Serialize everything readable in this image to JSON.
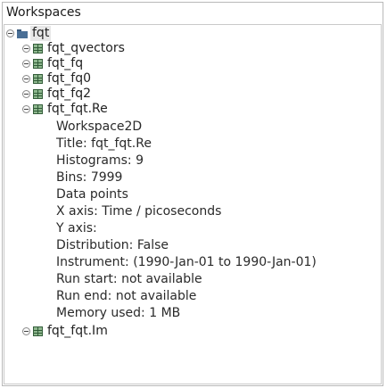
{
  "panel": {
    "title": "Workspaces"
  },
  "tree": {
    "root": {
      "label": "fqt",
      "icon": "folder-icon"
    },
    "items": [
      {
        "label": "fqt_qvectors",
        "icon": "table-icon"
      },
      {
        "label": "fqt_fq",
        "icon": "table-icon"
      },
      {
        "label": "fqt_fq0",
        "icon": "table-icon"
      },
      {
        "label": "fqt_fq2",
        "icon": "table-icon"
      },
      {
        "label": "fqt_fqt.Re",
        "icon": "table-icon"
      },
      {
        "label": "fqt_fqt.Im",
        "icon": "table-icon"
      }
    ],
    "details": [
      "Workspace2D",
      "Title: fqt_fqt.Re",
      "Histograms: 9",
      "Bins: 7999",
      "Data points",
      "X axis: Time / picoseconds",
      "Y axis:",
      "Distribution: False",
      "Instrument:  (1990-Jan-01 to 1990-Jan-01)",
      "Run start: not available",
      "Run end:  not available",
      "Memory used: 1 MB"
    ]
  }
}
